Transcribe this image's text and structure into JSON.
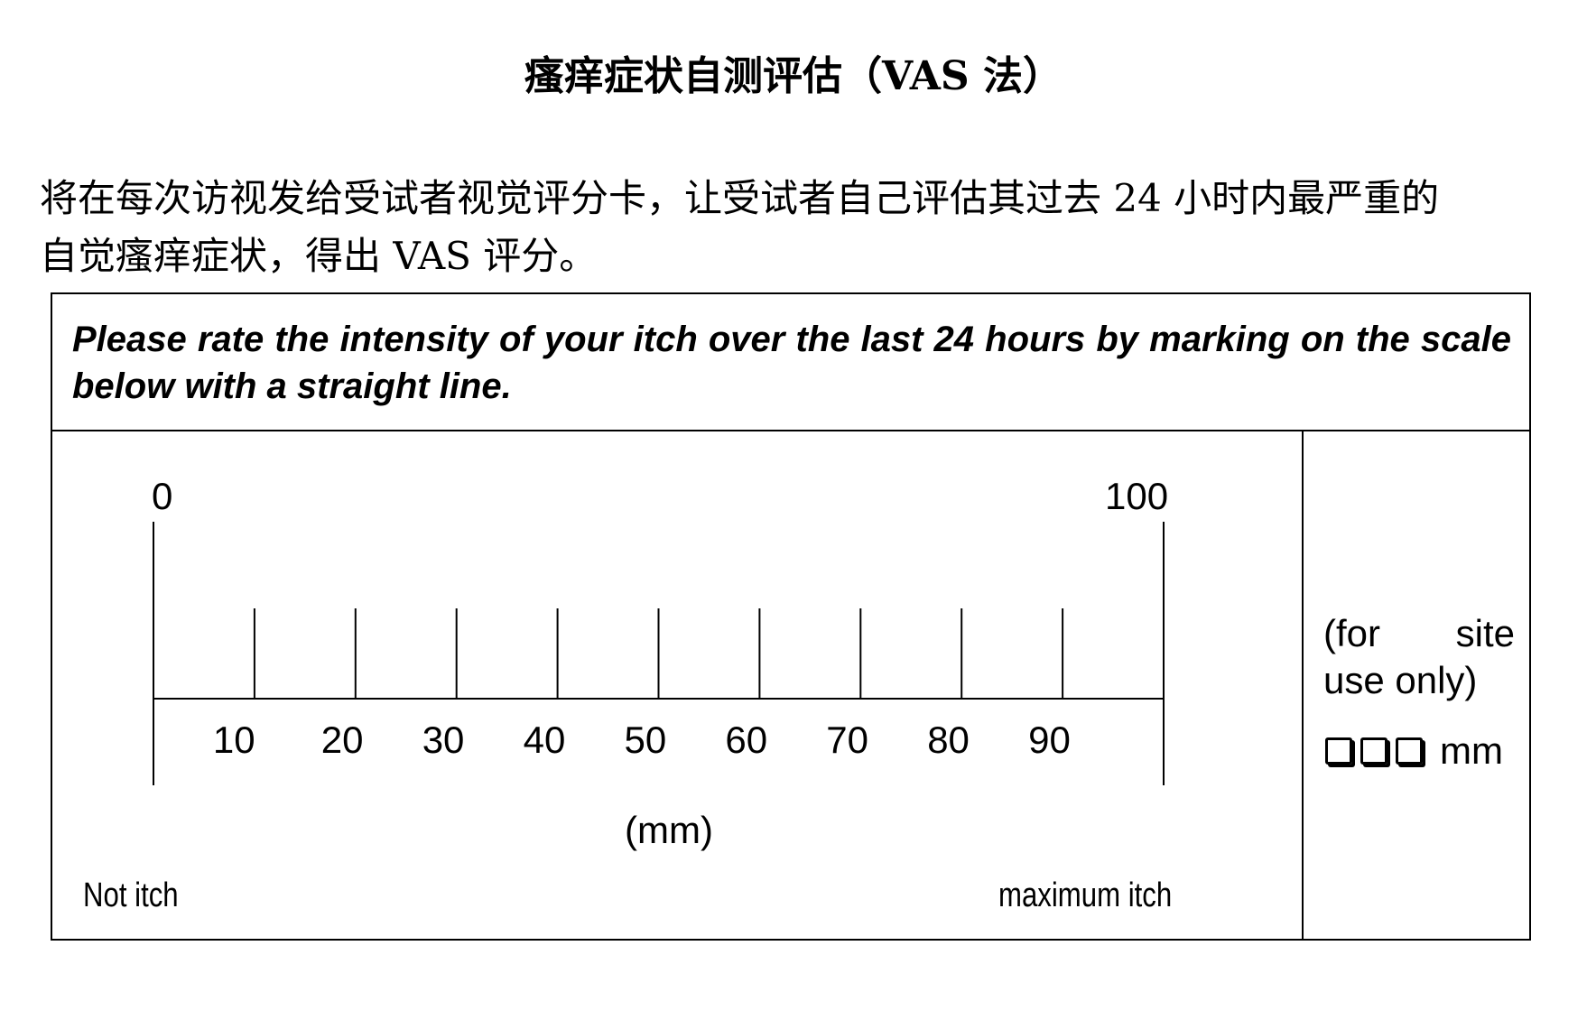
{
  "document": {
    "title": "瘙痒症状自测评估（VAS 法）",
    "intro_line1": "将在每次访视发给受试者视觉评分卡，让受试者自己评估其过去 24 小时内最严重的",
    "intro_line2": "自觉瘙痒症状，得出 VAS 评分。"
  },
  "form": {
    "instruction": "Please rate the intensity of your itch over the last 24 hours by marking on the scale below with a straight line.",
    "scale": {
      "start_label": "0",
      "end_label": "100",
      "tick_labels": [
        "10",
        "20",
        "30",
        "40",
        "50",
        "60",
        "70",
        "80",
        "90"
      ],
      "unit": "(mm)",
      "left_anchor": "Not itch",
      "right_anchor": "maximum itch"
    },
    "site_use": {
      "word1": "(for",
      "word2": "site",
      "line2": "use only)",
      "unit": "mm",
      "box_count": 3
    }
  }
}
